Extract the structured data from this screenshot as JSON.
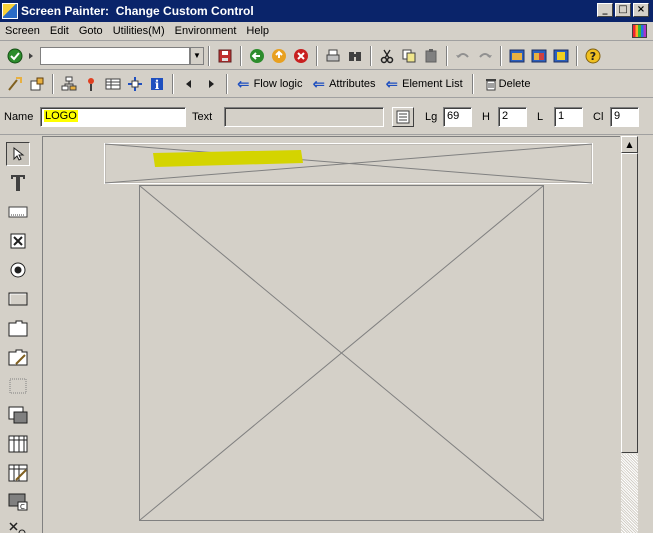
{
  "window": {
    "title": "Screen Painter:  Change Custom Control",
    "controls": {
      "minimize": "_",
      "maximize": "□",
      "close": "×"
    }
  },
  "menu": {
    "items": [
      "Screen",
      "Edit",
      "Goto",
      "Utilities(M)",
      "Environment",
      "Help"
    ]
  },
  "toolbar2": {
    "flow_logic": "Flow logic",
    "attributes": "Attributes",
    "element_list": "Element List",
    "delete": "Delete"
  },
  "attributes": {
    "name_label": "Name",
    "name_value": "LOGO",
    "text_label": "Text",
    "text_value": "",
    "lg_label": "Lg",
    "lg_value": "69",
    "h_label": "H",
    "h_value": "2",
    "l_label": "L",
    "l_value": "1",
    "cl_label": "Cl",
    "cl_value": "9"
  },
  "palette": [
    "select-pointer-icon",
    "text-field-icon",
    "input-field-icon",
    "checkbox-icon",
    "radio-button-icon",
    "pushbutton-icon",
    "tabstrip-icon",
    "tabstrip-wizard-icon",
    "box-icon",
    "subscreen-icon",
    "table-control-icon",
    "table-wizard-icon",
    "custom-control-icon",
    "status-icon"
  ],
  "colors": {
    "titlebar": "#0a246a",
    "highlight": "#ffff00",
    "selection_marker": "#d4d400",
    "surface": "#d4d0c8"
  }
}
